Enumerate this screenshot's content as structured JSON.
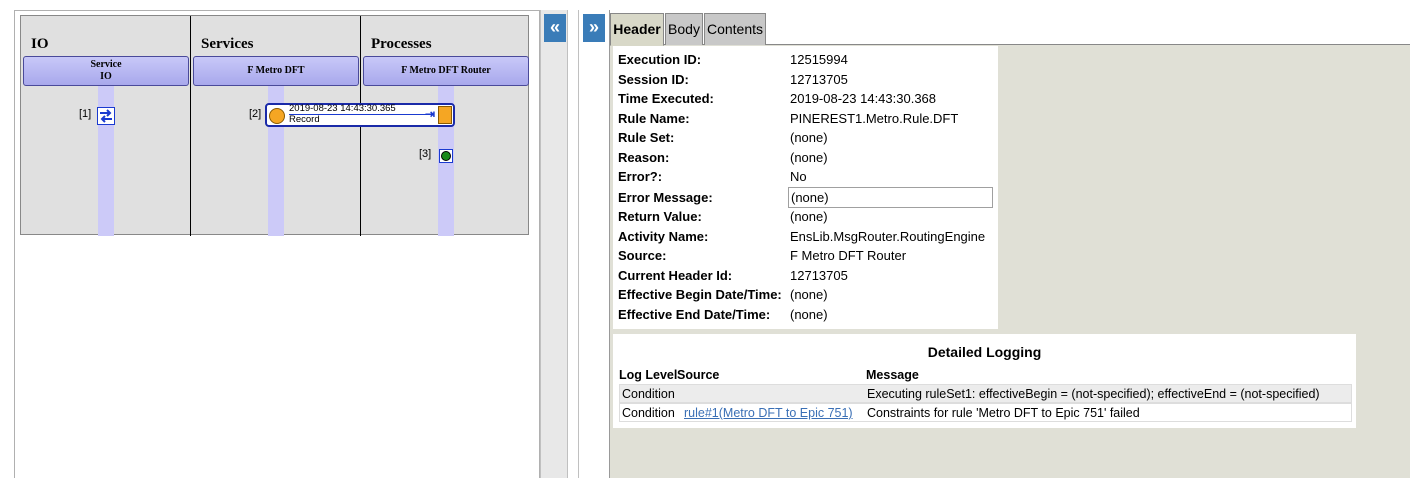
{
  "diagram": {
    "columns": [
      {
        "title": "IO",
        "header": [
          "Service",
          "IO"
        ]
      },
      {
        "title": "Services",
        "header": [
          "F Metro DFT"
        ]
      },
      {
        "title": "Processes",
        "header": [
          "F Metro DFT Router"
        ]
      }
    ],
    "items": [
      {
        "index": "[1]",
        "icon": "swap-arrows-icon"
      },
      {
        "index": "[2]",
        "timestamp": "2019-08-23 14:43:30.365",
        "type": "Record"
      },
      {
        "index": "[3]",
        "icon": "green-dot-icon"
      }
    ]
  },
  "splitter": {
    "collapse_label": "«",
    "expand_label": "»"
  },
  "tabs": [
    {
      "label": "Header",
      "active": true
    },
    {
      "label": "Body",
      "active": false
    },
    {
      "label": "Contents",
      "active": false
    }
  ],
  "header": {
    "execution_id": {
      "label": "Execution ID:",
      "value": "12515994"
    },
    "session_id": {
      "label": "Session ID:",
      "value": "12713705"
    },
    "time_executed": {
      "label": "Time Executed:",
      "value": "2019-08-23 14:43:30.368"
    },
    "rule_name": {
      "label": "Rule Name:",
      "value": "PINEREST1.Metro.Rule.DFT"
    },
    "rule_set": {
      "label": "Rule Set:",
      "value": "(none)"
    },
    "reason": {
      "label": "Reason:",
      "value": "(none)"
    },
    "error": {
      "label": "Error?:",
      "value": "No"
    },
    "error_message": {
      "label": "Error Message:",
      "value": "(none)"
    },
    "return_value": {
      "label": "Return Value:",
      "value": "(none)"
    },
    "activity_name": {
      "label": "Activity Name:",
      "value": "EnsLib.MsgRouter.RoutingEngine"
    },
    "source": {
      "label": "Source:",
      "value": "F Metro DFT Router"
    },
    "current_header_id": {
      "label": "Current Header Id:",
      "value": "12713705"
    },
    "effective_begin": {
      "label": "Effective Begin Date/Time:",
      "value": "(none)"
    },
    "effective_end": {
      "label": "Effective End Date/Time:",
      "value": "(none)"
    }
  },
  "logging": {
    "title": "Detailed Logging",
    "columns": {
      "level": "Log Level",
      "source": "Source",
      "message": "Message"
    },
    "rows": [
      {
        "level": "Condition",
        "source": "",
        "message": "Executing ruleSet1: effectiveBegin = (not-specified); effectiveEnd = (not-specified)"
      },
      {
        "level": "Condition",
        "source": "rule#1(Metro DFT to Epic 751)",
        "message": "Constraints for rule 'Metro DFT to Epic 751' failed"
      }
    ]
  },
  "colors": {
    "accent": "#3a7cb8",
    "lane": "#cccaf8",
    "box_orange": "#f5a623",
    "status_green": "#1a8a1a"
  }
}
